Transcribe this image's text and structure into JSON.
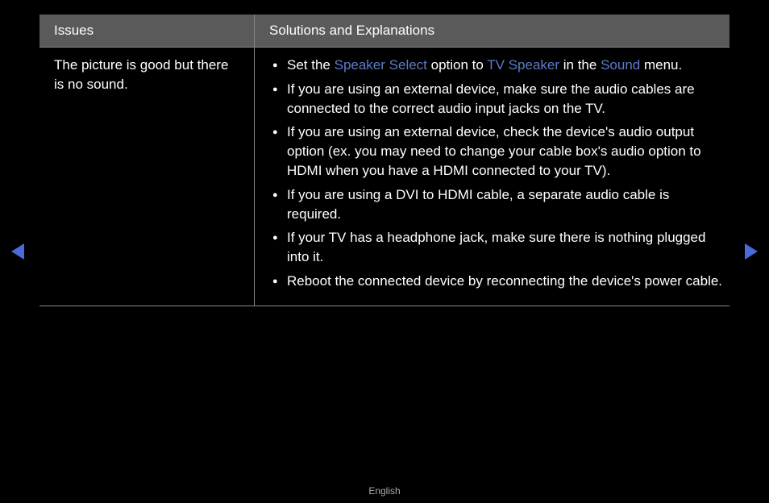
{
  "headers": {
    "issues": "Issues",
    "solutions": "Solutions and Explanations"
  },
  "row": {
    "issue": "The picture is good but there is no sound.",
    "sol1": {
      "t1": "Set the ",
      "h1": "Speaker Select",
      "t2": " option to ",
      "h2": "TV Speaker",
      "t3": " in the ",
      "h3": "Sound",
      "t4": " menu."
    },
    "sol2": "If you are using an external device, make sure the audio cables are connected to the correct audio input jacks on the TV.",
    "sol3": "If you are using an external device, check the device's audio output option (ex. you may need to change your cable box's audio option to HDMI when you have a HDMI connected to your TV).",
    "sol4": "If you are using a DVI to HDMI cable, a separate audio cable is required.",
    "sol5": "If your TV has a headphone jack, make sure there is nothing plugged into it.",
    "sol6": "Reboot the connected device by reconnecting the device's power cable."
  },
  "footer": {
    "language": "English"
  }
}
